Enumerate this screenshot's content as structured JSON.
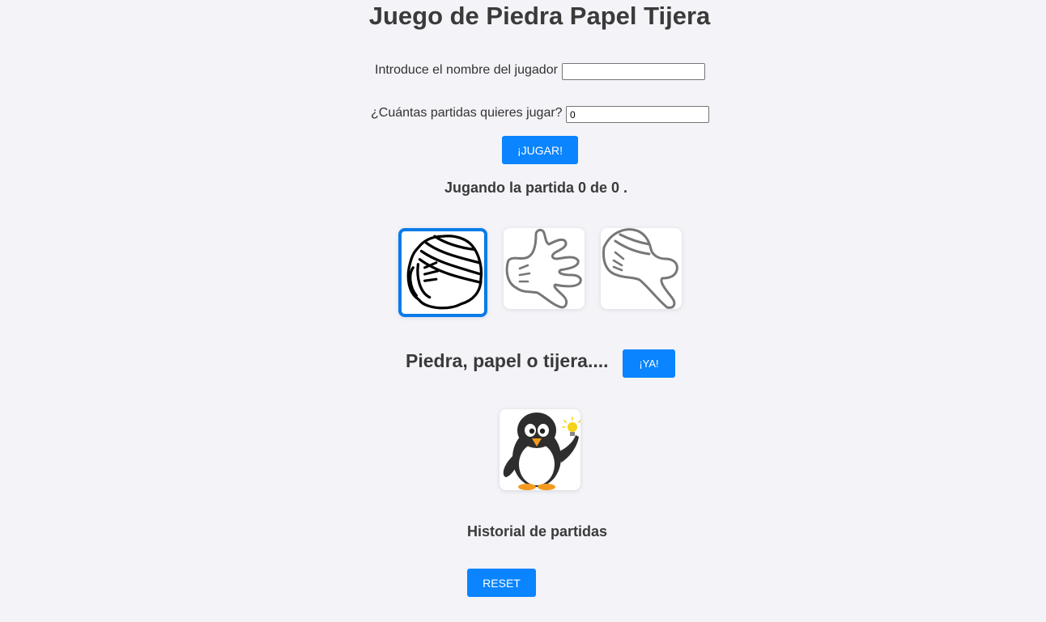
{
  "title": "Juego de Piedra Papel Tijera",
  "player": {
    "name_label": "Introduce el nombre del jugador",
    "name_value": ""
  },
  "games": {
    "count_label": "¿Cuántas partidas quieres jugar?",
    "count_value": "0"
  },
  "play_button": "¡JUGAR!",
  "progress": {
    "text": "Jugando la partida 0 de 0 ."
  },
  "choices": [
    {
      "name": "piedra",
      "icon": "rock-hand-icon",
      "selected": true
    },
    {
      "name": "papel",
      "icon": "paper-hand-icon",
      "selected": false
    },
    {
      "name": "tijera",
      "icon": "scissors-hand-icon",
      "selected": false
    }
  ],
  "prompt": {
    "text": "Piedra, papel o tijera....",
    "go_button": "¡YA!"
  },
  "opponent": {
    "icon": "penguin-lightbulb-icon"
  },
  "history": {
    "title": "Historial de partidas"
  },
  "reset_button": "RESET",
  "colors": {
    "accent": "#0a84ff",
    "selected_border": "#0a7bea",
    "background": "#f3f3f8",
    "text": "#333333"
  }
}
